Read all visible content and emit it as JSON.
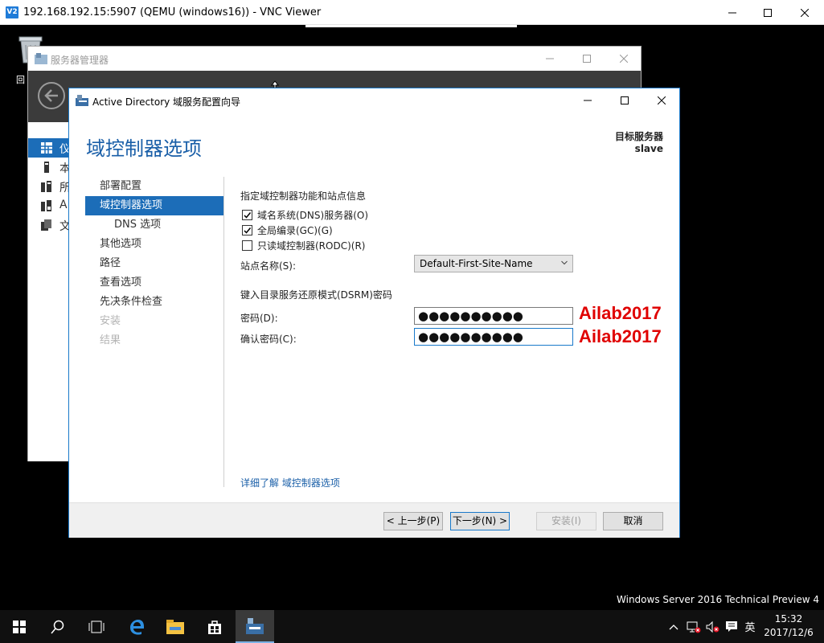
{
  "vnc": {
    "title": "192.168.192.15:5907 (QEMU (windows16)) - VNC Viewer",
    "logo_text": "V2"
  },
  "desktop": {
    "recycle_label": "回"
  },
  "server_manager": {
    "title": "服务器管理器",
    "sidebar": [
      {
        "label": "仪",
        "icon": "dashboard-icon",
        "active": true
      },
      {
        "label": "本",
        "icon": "local-server-icon",
        "active": false
      },
      {
        "label": "所",
        "icon": "all-servers-icon",
        "active": false
      },
      {
        "label": "A",
        "icon": "ad-ds-icon",
        "active": false
      },
      {
        "label": "文",
        "icon": "file-services-icon",
        "active": false
      }
    ]
  },
  "wizard": {
    "title": "Active Directory 域服务配置向导",
    "heading": "域控制器选项",
    "target_label": "目标服务器",
    "target_name": "slave",
    "nav": [
      {
        "label": "部署配置",
        "state": "normal"
      },
      {
        "label": "域控制器选项",
        "state": "active"
      },
      {
        "label": "DNS 选项",
        "state": "sub"
      },
      {
        "label": "其他选项",
        "state": "normal"
      },
      {
        "label": "路径",
        "state": "normal"
      },
      {
        "label": "查看选项",
        "state": "normal"
      },
      {
        "label": "先决条件检查",
        "state": "normal"
      },
      {
        "label": "安装",
        "state": "disabled"
      },
      {
        "label": "结果",
        "state": "disabled"
      }
    ],
    "section1_title": "指定域控制器功能和站点信息",
    "checkboxes": [
      {
        "label": "域名系统(DNS)服务器(O)",
        "checked": true
      },
      {
        "label": "全局编录(GC)(G)",
        "checked": true
      },
      {
        "label": "只读域控制器(RODC)(R)",
        "checked": false
      }
    ],
    "site_label": "站点名称(S):",
    "site_value": "Default-First-Site-Name",
    "section2_title": "键入目录服务还原模式(DSRM)密码",
    "password_label": "密码(D):",
    "password_value": "●●●●●●●●●●",
    "confirm_label": "确认密码(C):",
    "confirm_value": "●●●●●●●●●●",
    "annotation_password": "Ailab2017",
    "annotation_confirm": "Ailab2017",
    "learn_more": "详细了解 域控制器选项",
    "buttons": {
      "prev": "< 上一步(P)",
      "next": "下一步(N) >",
      "install": "安装(I)",
      "cancel": "取消"
    }
  },
  "watermark": "Windows Server 2016 Technical Preview 4",
  "taskbar": {
    "items": [
      "start-icon",
      "search-icon",
      "task-view-icon",
      "edge-icon",
      "file-explorer-icon",
      "store-icon",
      "server-manager-icon"
    ],
    "ime": "英",
    "time": "15:32",
    "date": "2017/12/6"
  },
  "colors": {
    "accent": "#1c6db8",
    "heading": "#1a5fa8",
    "annotation": "#e00000"
  }
}
